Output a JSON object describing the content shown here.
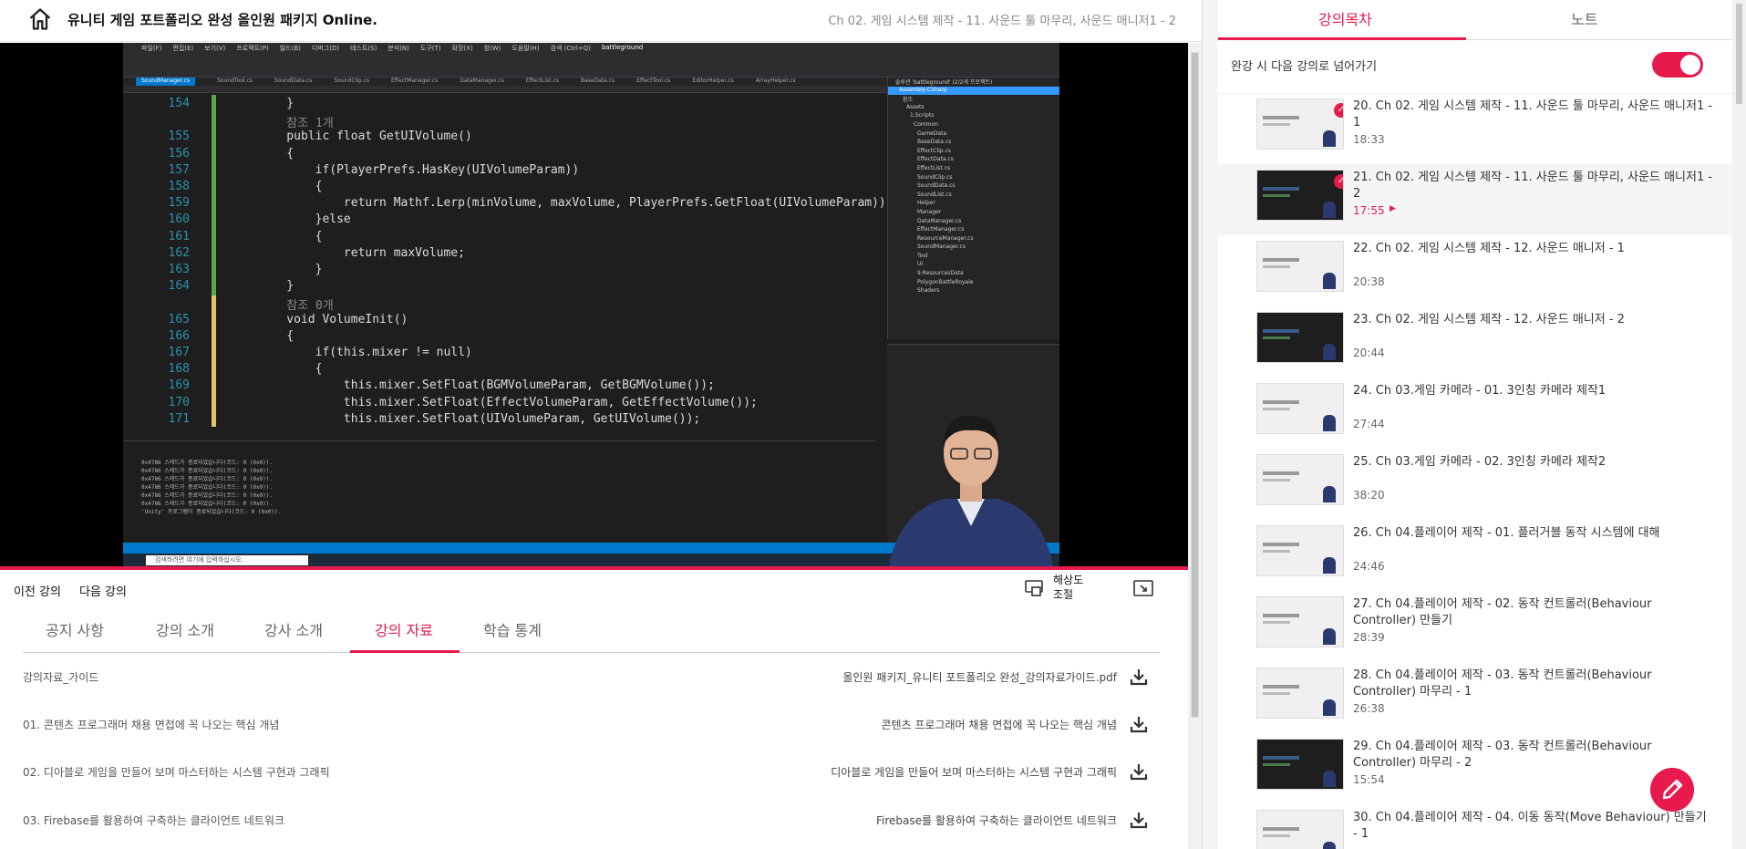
{
  "header": {
    "course_title": "유니티 게임 포트폴리오 완성 올인원 패키지 Online.",
    "lecture_title": "Ch 02. 게임 시스템 제작 - 11. 사운드 툴 마무리, 사운드 매니저1 - 2"
  },
  "video": {
    "vs_title": "battleground",
    "vs_menu": [
      "파일(F)",
      "편집(E)",
      "보기(V)",
      "프로젝트(P)",
      "빌드(B)",
      "디버그(D)",
      "테스트(S)",
      "분석(N)",
      "도구(T)",
      "확장(X)",
      "창(W)",
      "도움말(H)",
      "검색 (Ctrl+Q)"
    ],
    "vs_tabs": [
      "SoundManager.cs",
      "SoundTool.cs",
      "SoundData.cs",
      "SoundClip.cs",
      "EffectManager.cs",
      "DataManager.cs",
      "EffectList.cs",
      "BaseData.cs",
      "EffectTool.cs",
      "EditorHelper.cs",
      "ArrayHelper.cs"
    ],
    "code_lines": [
      {
        "n": "154",
        "t": "    }"
      },
      {
        "n": "",
        "t": "    참조 1개"
      },
      {
        "n": "155",
        "t": "    public float GetUIVolume()"
      },
      {
        "n": "156",
        "t": "    {"
      },
      {
        "n": "157",
        "t": "        if(PlayerPrefs.HasKey(UIVolumeParam))"
      },
      {
        "n": "158",
        "t": "        {"
      },
      {
        "n": "159",
        "t": "            return Mathf.Lerp(minVolume, maxVolume, PlayerPrefs.GetFloat(UIVolumeParam));"
      },
      {
        "n": "160",
        "t": "        }else"
      },
      {
        "n": "161",
        "t": "        {"
      },
      {
        "n": "162",
        "t": "            return maxVolume;"
      },
      {
        "n": "163",
        "t": "        }"
      },
      {
        "n": "164",
        "t": "    }"
      },
      {
        "n": "",
        "t": "    참조 0개"
      },
      {
        "n": "165",
        "t": "    void VolumeInit()"
      },
      {
        "n": "166",
        "t": "    {"
      },
      {
        "n": "167",
        "t": "        if(this.mixer != null)"
      },
      {
        "n": "168",
        "t": "        {"
      },
      {
        "n": "169",
        "t": "            this.mixer.SetFloat(BGMVolumeParam, GetBGMVolume());"
      },
      {
        "n": "170",
        "t": "            this.mixer.SetFloat(EffectVolumeParam, GetEffectVolume());"
      },
      {
        "n": "171",
        "t": "            this.mixer.SetFloat(UIVolumeParam, GetUIVolume());"
      }
    ],
    "solution_items": [
      "솔루션 'battleground' (2/2개 프로젝트)",
      "Assembly-CSharp",
      "참조",
      "Assets",
      "1.Scripts",
      "Common",
      "GameData",
      "BaseData.cs",
      "EffectClip.cs",
      "EffectData.cs",
      "EffectList.cs",
      "SoundClip.cs",
      "SoundData.cs",
      "SoundList.cs",
      "Helper",
      "Manager",
      "DataManager.cs",
      "EffectManager.cs",
      "ResourceManager.cs",
      "SoundManager.cs",
      "Tool",
      "UI",
      "9.ResourcesData",
      "PolygonBattleRoyale",
      "Shaders"
    ],
    "output_lines": [
      "0x4786 스레드가 종료되었습니다(코드: 0 (0x0)).",
      "0x4786 스레드가 종료되었습니다(코드: 0 (0x0)).",
      "0x4786 스레드가 종료되었습니다(코드: 0 (0x0)).",
      "0x4786 스레드가 종료되었습니다(코드: 0 (0x0)).",
      "0x4786 스레드가 종료되었습니다(코드: 0 (0x0)).",
      "0x4786 스레드가 종료되었습니다(코드: 0 (0x0)).",
      "'Unity' 프로그램이 종료되었습니다(코드: 0 (0x0))."
    ],
    "taskbar_search": "검색하려면 여기에 입력하십시오.",
    "progress_pct": 100
  },
  "controls": {
    "prev": "이전 강의",
    "next": "다음 강의",
    "resolution": "해상도 조절"
  },
  "tabs": [
    "공지 사항",
    "강의 소개",
    "강사 소개",
    "강의 자료",
    "학습 통계"
  ],
  "active_tab": "강의 자료",
  "resources": [
    {
      "left": "강의자료_가이드",
      "right": "올인원 패키지_유니티 포트폴리오 완성_강의자료가이드.pdf"
    },
    {
      "left": "01. 콘텐츠 프로그래머 채용 면접에 꼭 나오는 핵심 개념",
      "right": "콘텐츠 프로그래머 채용 면접에 꼭 나오는 핵심 개념"
    },
    {
      "left": "02. 디아블로 게임을 만들어 보며 마스터하는 시스템 구현과 그래픽",
      "right": "디아블로 게임을 만들어 보며 마스터하는 시스템 구현과 그래픽"
    },
    {
      "left": "03. Firebase를 활용하여 구축하는 클라이언트 네트워크",
      "right": "Firebase를 활용하여 구축하는 클라이언트 네트워크"
    }
  ],
  "sidebar": {
    "tab_toc": "강의목차",
    "tab_note": "노트",
    "autoplay_label": "완강 시 다음 강의로 넘어가기",
    "autoplay_on": true,
    "lectures": [
      {
        "title": "20. Ch 02. 게임 시스템 제작 - 11. 사운드 툴 마무리, 사운드 매니저1 - 1",
        "time": "18:33",
        "done": true,
        "current": false,
        "dark": false
      },
      {
        "title": "21. Ch 02. 게임 시스템 제작 - 11. 사운드 툴 마무리, 사운드 매니저1 - 2",
        "time": "17:55",
        "done": true,
        "current": true,
        "dark": true
      },
      {
        "title": "22. Ch 02. 게임 시스템 제작 - 12. 사운드 매니저 - 1",
        "time": "20:38",
        "done": false,
        "current": false,
        "dark": false
      },
      {
        "title": "23. Ch 02. 게임 시스템 제작 - 12. 사운드 매니저 - 2",
        "time": "20:44",
        "done": false,
        "current": false,
        "dark": true
      },
      {
        "title": "24. Ch 03.게임 카메라 - 01. 3인칭 카메라 제작1",
        "time": "27:44",
        "done": false,
        "current": false,
        "dark": false
      },
      {
        "title": "25. Ch 03.게임 카메라 - 02. 3인칭 카메라 제작2",
        "time": "38:20",
        "done": false,
        "current": false,
        "dark": false
      },
      {
        "title": "26. Ch 04.플레이어 제작 - 01. 플러거블 동작 시스템에 대해",
        "time": "24:46",
        "done": false,
        "current": false,
        "dark": false
      },
      {
        "title": "27. Ch 04.플레이어 제작 - 02. 동작 컨트롤러(Behaviour Controller) 만들기",
        "time": "28:39",
        "done": false,
        "current": false,
        "dark": false
      },
      {
        "title": "28. Ch 04.플레이어 제작 - 03. 동작 컨트롤러(Behaviour Controller) 마무리 - 1",
        "time": "26:38",
        "done": false,
        "current": false,
        "dark": false
      },
      {
        "title": "29. Ch 04.플레이어 제작 - 03. 동작 컨트롤러(Behaviour Controller) 마무리 - 2",
        "time": "15:54",
        "done": false,
        "current": false,
        "dark": true
      },
      {
        "title": "30. Ch 04.플레이어 제작 - 04. 이동 동작(Move Behaviour) 만들기 - 1",
        "time": "",
        "done": false,
        "current": false,
        "dark": false
      }
    ]
  },
  "colors": {
    "accent": "#e8194d"
  }
}
